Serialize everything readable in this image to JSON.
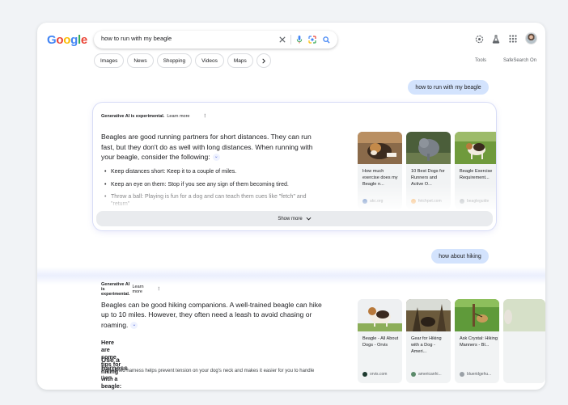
{
  "header": {
    "logo_letters": [
      {
        "ch": "G",
        "color": "#4285F4"
      },
      {
        "ch": "o",
        "color": "#EA4335"
      },
      {
        "ch": "o",
        "color": "#FBBC05"
      },
      {
        "ch": "g",
        "color": "#4285F4"
      },
      {
        "ch": "l",
        "color": "#34A853"
      },
      {
        "ch": "e",
        "color": "#EA4335"
      }
    ],
    "search_query": "how to run with my beagle",
    "icons": [
      "clear-icon",
      "microphone-icon",
      "lens-icon",
      "search-icon"
    ],
    "right_icons": [
      "labs-icon",
      "flask-icon",
      "apps-grid-icon"
    ]
  },
  "chips": [
    "Images",
    "News",
    "Shopping",
    "Videos",
    "Maps"
  ],
  "tools_label": "Tools",
  "safesearch_label": "SafeSearch On",
  "query_1": "how to run with my beagle",
  "query_2": "how about hiking",
  "overview_1": {
    "experimental": "Generative AI is experimental.",
    "learn_more": "Learn more",
    "menu_glyph": "⋮",
    "lead": "Beagles are good running partners for short distances. They can run fast, but they don't do as well with long distances. When running with your beagle, consider the following:",
    "bullets": [
      "Keep distances short: Keep it to a couple of miles.",
      "Keep an eye on them: Stop if you see any sign of them becoming tired.",
      "Throw a ball: Playing is fun for a dog and can teach them cues like \"fetch\" and \"return\""
    ],
    "show_more": "Show more",
    "sources": [
      {
        "title": "How much exercise does my Beagle n...",
        "site": "akc.org"
      },
      {
        "title": "10 Best Dogs for Runners and Active O...",
        "site": "fetchpet.com"
      },
      {
        "title": "Beagle Exercise Requirement...",
        "site": "beagleguide"
      }
    ]
  },
  "overview_2": {
    "experimental": "Generative AI is experimental.",
    "learn_more": "Learn more",
    "menu_glyph": "⋮",
    "lead": "Beagles can be good hiking companions. A well-trained beagle can hike up to 10 miles. However, they often need a leash to avoid chasing or roaming.",
    "tips": "Here are some tips for hiking with a beagle:",
    "harness_heading": "Use a harness",
    "harness_text": "A chest-led harness helps prevent tension on your dog's neck and makes it easier for you to handle them.",
    "sources": [
      {
        "title": "Beagle - All About Dogs - Orvis",
        "site": "orvis.com"
      },
      {
        "title": "Gear for Hiking with a Dog - Ameri...",
        "site": "americanhi..."
      },
      {
        "title": "Ask Crystal: Hiking Manners - Bl...",
        "site": "blueridgehu..."
      }
    ]
  }
}
